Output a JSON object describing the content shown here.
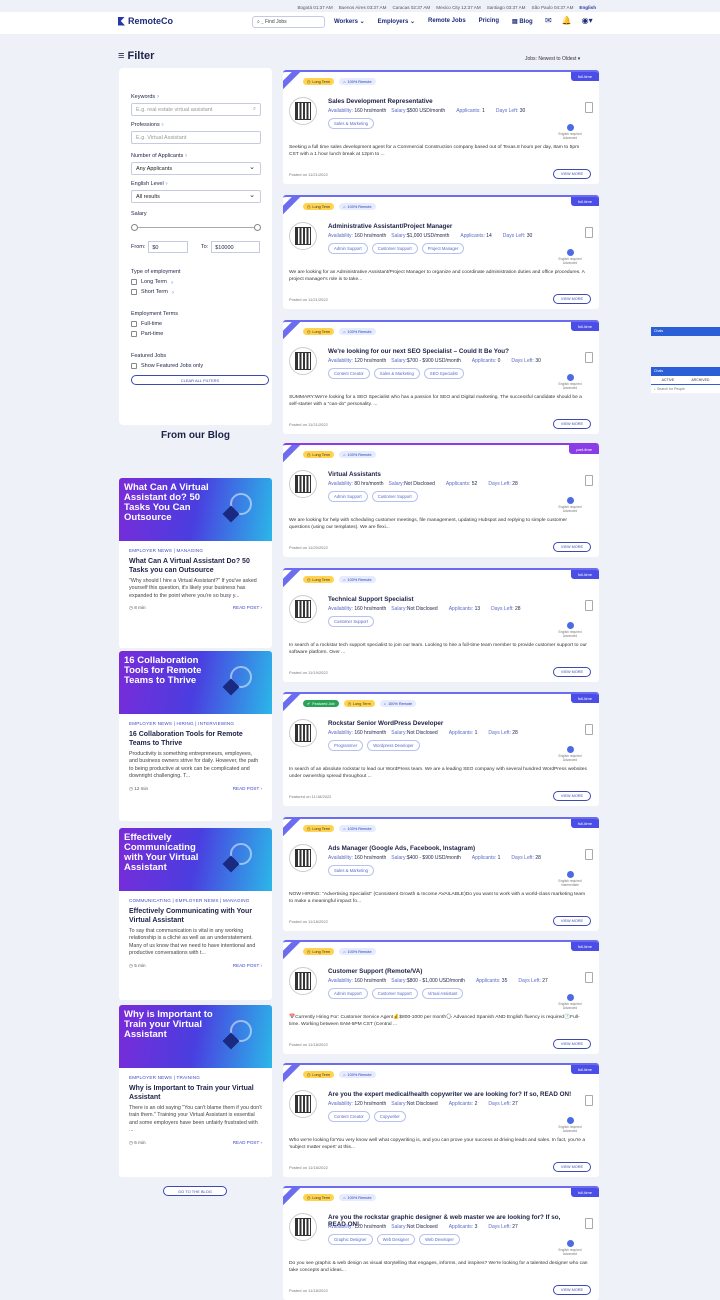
{
  "clocks": [
    "Bogotá 01:37 AM",
    "Buenos Aires 03:37 AM",
    "Caracas 02:37 AM",
    "Mexico City 12:37 AM",
    "Santiago 03:37 AM",
    "São Paulo 04:37 AM"
  ],
  "language": "English",
  "nav": {
    "logo": "RemoteCo",
    "search": "Find Jobs",
    "links": [
      "Workers ⌄",
      "Employers ⌄",
      "Remote Jobs",
      "Pricing",
      "Blog"
    ]
  },
  "filter": {
    "title": "Filter",
    "sort": "Jobs: Newest to Oldest",
    "keywords_label": "Keywords",
    "keywords_placeholder": "E.g. real estate virtual assistant",
    "professions_label": "Professions",
    "professions_placeholder": "E.g. Virtual Assistant",
    "applicants_label": "Number of Applicants",
    "applicants_value": "Any Applicants",
    "english_label": "English Level",
    "english_value": "All results",
    "salary_label": "Salary",
    "from_label": "From:",
    "from_value": "$0",
    "to_label": "To:",
    "to_value": "$10000",
    "type_label": "Type of employment",
    "type_opts": [
      "Long Term",
      "Short Term"
    ],
    "terms_label": "Employment Terms",
    "terms_opts": [
      "Full-time",
      "Part-time"
    ],
    "featured_label": "Featured Jobs",
    "featured_opt": "Show Featured Jobs only",
    "clear": "CLEAR ALL FILTERS"
  },
  "blog": {
    "title": "From our Blog",
    "goto": "GO TO THE BLOG",
    "read": "READ POST",
    "posts": [
      {
        "img": "What Can A Virtual Assistant do? 50 Tasks You Can Outsource",
        "cats": "EMPLOYER NEWS | MANAGING",
        "title": "What Can A Virtual Assistant Do? 50 Tasks you can Outsource",
        "text": "\"Why should I hire a Virtual Assistant?\" If you've asked yourself this question, it's likely your business has expanded to the point where you're so busy y...",
        "time": "8 min"
      },
      {
        "img": "16 Collaboration Tools for Remote Teams to Thrive",
        "cats": "EMPLOYER NEWS | HIRING | INTERVIEWING",
        "title": "16 Collaboration Tools for Remote Teams to Thrive",
        "text": "Productivity is something entrepreneurs, employees, and business owners strive for daily. However, the path to being productive at work can be complicated and downright challenging. T...",
        "time": "12 min"
      },
      {
        "img": "Effectively Communicating with Your Virtual Assistant",
        "cats": "COMMUNICATING | EMPLOYER NEWS | MANAGING",
        "title": "Effectively Communicating with Your Virtual Assistant",
        "text": "To say that communication is vital in any working relationship is a cliché as well as an understatement. Many of us know that we need to have intentional and productive conversations with t...",
        "time": "5 min"
      },
      {
        "img": "Why is Important to Train your Virtual Assistant",
        "cats": "EMPLOYER NEWS | TRAINING",
        "title": "Why is Important to Train your Virtual Assistant",
        "text": "There is an old saying \"You can't blame them if you don't train them.\" Training your Virtual Assistant is essential and some employers have been unfairly frustrated with ...",
        "time": "6 min"
      }
    ]
  },
  "jobs": [
    {
      "type": "full-time",
      "title": "Sales Development Representative",
      "avail": "160 hrs/month",
      "salary": "$500 USD/month",
      "applicants": "1",
      "days": "30",
      "skills": [
        "Sales & Marketing"
      ],
      "eng": "Advanced",
      "desc": "Seeking a full time sales development agent for a Commercial Construction company based out of Texas.8 hours per day, 8am to 5pm CST with a 1 hour lunch break at 12pm to ...",
      "posted": "Posted on 11/21/2022"
    },
    {
      "type": "full-time",
      "title": "Administrative Assistant/Project Manager",
      "avail": "160 hrs/month",
      "salary": "$1,000 USD/month",
      "applicants": "14",
      "days": "30",
      "skills": [
        "Admin Support",
        "Customer Support",
        "Project Manager"
      ],
      "eng": "Advanced",
      "desc": "We are looking for an Administrative Assistant/Project Manager to organize and coordinate administration duties and office procedures. A project manager's role is to take...",
      "posted": "Posted on 11/21/2022"
    },
    {
      "type": "full-time",
      "title": "We're looking for our next SEO Specialist – Could It Be You?",
      "avail": "120 hrs/month",
      "salary": "$700 - $900 USD/month",
      "applicants": "0",
      "days": "30",
      "skills": [
        "Content Creator",
        "Sales & Marketing",
        "SEO Specialist"
      ],
      "eng": "Advanced",
      "desc": "SUMMARY:We're looking for a SEO Specialist who has a passion for SEO and Digital marketing. The successful candidate should be a self-starter with a \"can-do\" personality. ...",
      "posted": "Posted on 11/21/2022"
    },
    {
      "type": "part-time",
      "title": "Virtual Assistants",
      "avail": "80 hrs/month",
      "salary": "Not Disclosed",
      "applicants": "52",
      "days": "28",
      "skills": [
        "Admin Support",
        "Customer Support"
      ],
      "eng": "Advanced",
      "desc": "We are looking for help with scheduling customer meetings, file management, updating Hubspot and replying to simple customer questions (using our templates). We are flexi...",
      "posted": "Posted on 11/20/2022"
    },
    {
      "type": "full-time",
      "title": "Technical Support Specialist",
      "avail": "160 hrs/month",
      "salary": "Not Disclosed",
      "applicants": "13",
      "days": "28",
      "skills": [
        "Customer Support"
      ],
      "eng": "Advanced",
      "desc": "In search of a rockstar tech support specialist to join our team. Looking to hire a full-time team member to provide customer support to our software platform. Over ...",
      "posted": "Posted on 11/19/2022"
    },
    {
      "type": "full-time",
      "title": "Rockstar Senior WordPress Developer",
      "avail": "160 hrs/month",
      "salary": "Not Disclosed",
      "applicants": "1",
      "days": "28",
      "skills": [
        "Programmer",
        "Wordpress Developer"
      ],
      "eng": "Advanced",
      "desc": "In search of an absolute rockstar to lead our WordPress team. We are a leading SEO company with several hundred WordPress websites under ownership spread throughout ...",
      "posted": "Featured on 11/18/2022"
    },
    {
      "type": "full-time",
      "title": "Ads Manager (Google Ads, Facebook, Instagram)",
      "avail": "160 hrs/month",
      "salary": "$400 - $900 USD/month",
      "applicants": "1",
      "days": "28",
      "skills": [
        "Sales & Marketing"
      ],
      "eng": "Intermediate",
      "desc": "NOW HIRING: \"Advertising Specialist\" (Consistent Growth & Income AVAILABLE)Do you want to work with a world-class marketing team to make a meaningful impact fo...",
      "posted": "Posted on 11/18/2022"
    },
    {
      "type": "full-time",
      "title": "Customer Support (Remote/VA)",
      "avail": "160 hrs/month",
      "salary": "$800 - $1,000 USD/month",
      "applicants": "35",
      "days": "27",
      "skills": [
        "Admin Support",
        "Customer Support",
        "Virtual Assistant"
      ],
      "eng": "Advanced",
      "desc": "📅Currently Hiring For: Customer Service Agent💰$800-1000 per month🗣 Advanced Spanish AND English fluency is required🕐Full-time. Working between 8AM-5PM CST (Central ...",
      "posted": "Posted on 11/18/2022"
    },
    {
      "type": "full-time",
      "title": "Are you the expert medical/health copywriter we are looking for? If so, READ ON!",
      "avail": "120 hrs/month",
      "salary": "Not Disclosed",
      "applicants": "2",
      "days": "27",
      "skills": [
        "Content Creator",
        "Copywriter"
      ],
      "eng": "Advanced",
      "desc": "Who we're looking forYou very know well what copywriting is, and you can prove your success at driving leads and sales. In fact, you're a 'subject matter expert' at this...",
      "posted": "Posted on 11/18/2022"
    },
    {
      "type": "full-time",
      "title": "Are you the rockstar graphic designer & web master we are looking for? If so, READ ON!",
      "avail": "120 hrs/month",
      "salary": "Not Disclosed",
      "applicants": "3",
      "days": "27",
      "skills": [
        "Graphic Designer",
        "Web Designer",
        "Web Developer"
      ],
      "eng": "Advanced",
      "desc": "Do you see graphic & web design as visual storytelling that engages, informs, and inspires? We're looking for a talented designer who can take concepts and ideas...",
      "posted": "Posted on 11/18/2022"
    }
  ],
  "labels": {
    "long": "Long Term",
    "remote": "100% Remote",
    "featured": "Featured Job",
    "avail": "Availability:",
    "salary": "Salary:",
    "applicants": "Applicants:",
    "days": "Days Left:",
    "eng": "English required",
    "view": "VIEW MORE"
  },
  "chat": {
    "title": "Chats",
    "tab1": "ACTIVE",
    "tab2": "ARCHIVED",
    "search": "Search for People"
  }
}
